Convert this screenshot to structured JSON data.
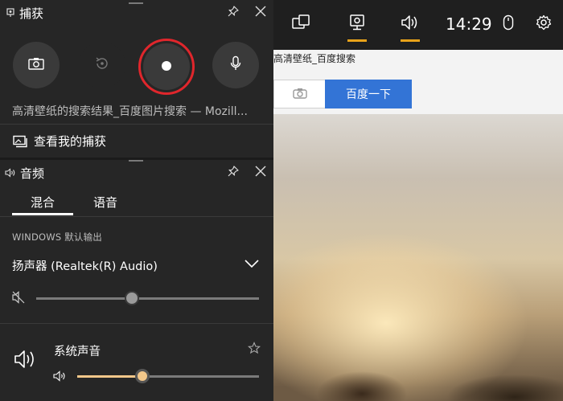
{
  "background": {
    "tab_title": "高清壁纸_百度搜索",
    "search_button_label": "百度一下"
  },
  "gamebar": {
    "clock": "14:29",
    "buttons": [
      {
        "name": "widget-menu-icon",
        "active": false
      },
      {
        "name": "capture-widget-icon",
        "active": true
      },
      {
        "name": "audio-widget-icon",
        "active": true
      },
      {
        "name": "mouse-icon",
        "active": false
      },
      {
        "name": "settings-icon",
        "active": false
      }
    ]
  },
  "capture": {
    "title": "捕获",
    "description": "高清壁纸的搜索结果_百度图片搜索 — Mozill...",
    "see_captures_label": "查看我的捕获",
    "buttons": [
      "screenshot",
      "record-last-30s",
      "start-recording",
      "microphone"
    ]
  },
  "audio": {
    "title": "音频",
    "tabs": [
      {
        "label": "混合",
        "selected": true
      },
      {
        "label": "语音",
        "selected": false
      }
    ],
    "default_output_label": "WINDOWS 默认输出",
    "device": "扬声器 (Realtek(R) Audio)",
    "device_volume": 0.43,
    "device_muted": true,
    "app_name": "系统声音",
    "app_volume": 0.36,
    "accent_color": "#f2c78a"
  }
}
